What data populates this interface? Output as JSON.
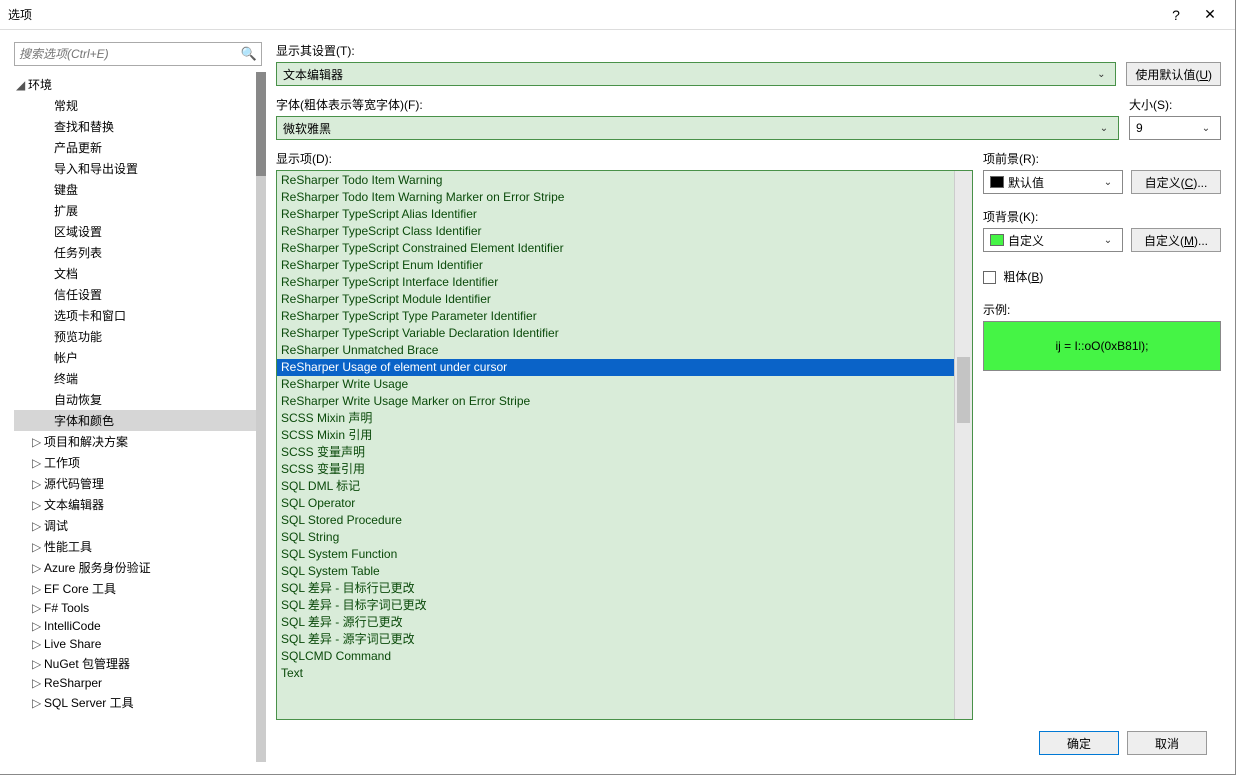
{
  "window": {
    "title": "选项"
  },
  "search": {
    "placeholder": "搜索选项(Ctrl+E)"
  },
  "tree": [
    {
      "label": "环境",
      "level": 0,
      "caret": "◢",
      "sel": false
    },
    {
      "label": "常规",
      "level": 2,
      "sel": false
    },
    {
      "label": "查找和替换",
      "level": 2,
      "sel": false
    },
    {
      "label": "产品更新",
      "level": 2,
      "sel": false
    },
    {
      "label": "导入和导出设置",
      "level": 2,
      "sel": false
    },
    {
      "label": "键盘",
      "level": 2,
      "sel": false
    },
    {
      "label": "扩展",
      "level": 2,
      "sel": false
    },
    {
      "label": "区域设置",
      "level": 2,
      "sel": false
    },
    {
      "label": "任务列表",
      "level": 2,
      "sel": false
    },
    {
      "label": "文档",
      "level": 2,
      "sel": false
    },
    {
      "label": "信任设置",
      "level": 2,
      "sel": false
    },
    {
      "label": "选项卡和窗口",
      "level": 2,
      "sel": false
    },
    {
      "label": "预览功能",
      "level": 2,
      "sel": false
    },
    {
      "label": "帐户",
      "level": 2,
      "sel": false
    },
    {
      "label": "终端",
      "level": 2,
      "sel": false
    },
    {
      "label": "自动恢复",
      "level": 2,
      "sel": false
    },
    {
      "label": "字体和颜色",
      "level": 2,
      "sel": true
    },
    {
      "label": "项目和解决方案",
      "level": 1,
      "caret": "▷",
      "sel": false
    },
    {
      "label": "工作项",
      "level": 1,
      "caret": "▷",
      "sel": false
    },
    {
      "label": "源代码管理",
      "level": 1,
      "caret": "▷",
      "sel": false
    },
    {
      "label": "文本编辑器",
      "level": 1,
      "caret": "▷",
      "sel": false
    },
    {
      "label": "调试",
      "level": 1,
      "caret": "▷",
      "sel": false
    },
    {
      "label": "性能工具",
      "level": 1,
      "caret": "▷",
      "sel": false
    },
    {
      "label": "Azure 服务身份验证",
      "level": 1,
      "caret": "▷",
      "sel": false
    },
    {
      "label": "EF Core 工具",
      "level": 1,
      "caret": "▷",
      "sel": false
    },
    {
      "label": "F# Tools",
      "level": 1,
      "caret": "▷",
      "sel": false
    },
    {
      "label": "IntelliCode",
      "level": 1,
      "caret": "▷",
      "sel": false
    },
    {
      "label": "Live Share",
      "level": 1,
      "caret": "▷",
      "sel": false
    },
    {
      "label": "NuGet 包管理器",
      "level": 1,
      "caret": "▷",
      "sel": false
    },
    {
      "label": "ReSharper",
      "level": 1,
      "caret": "▷",
      "sel": false
    },
    {
      "label": "SQL Server 工具",
      "level": 1,
      "caret": "▷",
      "sel": false
    }
  ],
  "labels": {
    "show_settings": "显示其设置(T):",
    "font": "字体(粗体表示等宽字体)(F):",
    "size": "大小(S):",
    "display_items": "显示项(D):",
    "item_fore": "项前景(R):",
    "item_back": "项背景(K):",
    "bold": "粗体(B)",
    "sample": "示例:",
    "use_defaults": "使用默认值(U)",
    "custom_fg": "自定义(C)...",
    "custom_bg": "自定义(M)...",
    "ok": "确定",
    "cancel": "取消"
  },
  "values": {
    "show_settings": "文本编辑器",
    "font": "微软雅黑",
    "size": "9",
    "item_fore": "默认值",
    "item_back": "自定义",
    "sample_text": "ij = I::oO(0xB81l);",
    "fore_color": "#000000",
    "back_color": "#45f445"
  },
  "display_items": [
    "ReSharper Todo Item Warning",
    "ReSharper Todo Item Warning Marker on Error Stripe",
    "ReSharper TypeScript Alias Identifier",
    "ReSharper TypeScript Class Identifier",
    "ReSharper TypeScript Constrained Element Identifier",
    "ReSharper TypeScript Enum Identifier",
    "ReSharper TypeScript Interface Identifier",
    "ReSharper TypeScript Module Identifier",
    "ReSharper TypeScript Type Parameter Identifier",
    "ReSharper TypeScript Variable Declaration Identifier",
    "ReSharper Unmatched Brace",
    "ReSharper Usage of element under cursor",
    "ReSharper Write Usage",
    "ReSharper Write Usage Marker on Error Stripe",
    "SCSS Mixin 声明",
    "SCSS Mixin 引用",
    "SCSS 变量声明",
    "SCSS 变量引用",
    "SQL DML 标记",
    "SQL Operator",
    "SQL Stored Procedure",
    "SQL String",
    "SQL System Function",
    "SQL System Table",
    "SQL 差异 - 目标行已更改",
    "SQL 差异 - 目标字词已更改",
    "SQL 差异 - 源行已更改",
    "SQL 差异 - 源字词已更改",
    "SQLCMD Command",
    "Text"
  ],
  "display_selected_index": 11
}
